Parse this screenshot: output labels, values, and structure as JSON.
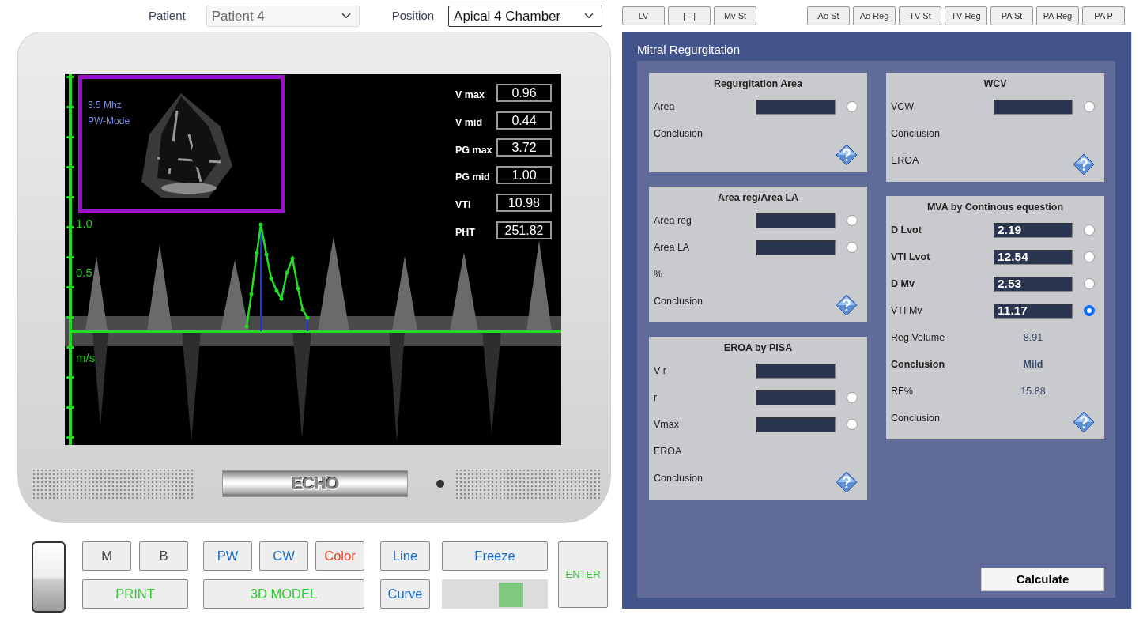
{
  "top_bar": {
    "patient": {
      "label": "Patient",
      "value": "Patient 4",
      "disabled": true
    },
    "position": {
      "label": "Position",
      "value": "Apical 4 Chamber",
      "disabled": false
    }
  },
  "toolbar_groups": [
    [
      "LV",
      "|- -|",
      "Mv St"
    ],
    [
      "Ao St",
      "Ao Reg",
      "TV St",
      "TV Reg",
      "PA St",
      "PA Reg",
      "PA P"
    ]
  ],
  "screen": {
    "mode_lines": [
      "3.5 Mhz",
      "PW-Mode"
    ],
    "axis_labels": [
      "1.0",
      "0.5",
      "m/s"
    ],
    "measurements": [
      {
        "label": "V max",
        "value": "0.96"
      },
      {
        "label": "V mid",
        "value": "0.44"
      },
      {
        "label": "PG max",
        "value": "3.72"
      },
      {
        "label": "PG mid",
        "value": "1.00"
      },
      {
        "label": "VTI",
        "value": "10.98"
      },
      {
        "label": "PHT",
        "value": "251.82"
      }
    ]
  },
  "monitor": {
    "logo": "ECHO"
  },
  "controls": {
    "groups": [
      {
        "buttons": [
          {
            "label": "M",
            "kind": "small",
            "color": "#444444"
          },
          {
            "label": "B",
            "kind": "small",
            "color": "#444444"
          },
          {
            "label": "PRINT",
            "kind": "wide",
            "color": "#2ecc2e"
          }
        ]
      },
      {
        "buttons": [
          {
            "label": "PW",
            "kind": "small",
            "color": "#1a6fd0"
          },
          {
            "label": "CW",
            "kind": "small",
            "color": "#1a6fd0"
          },
          {
            "label": "Color",
            "kind": "small",
            "color": "#f0401c"
          },
          {
            "label": "3D MODEL",
            "kind": "wide",
            "color": "#2ecc2e"
          }
        ]
      },
      {
        "buttons": [
          {
            "label": "Line",
            "kind": "small",
            "color": "#1a6fd0"
          },
          {
            "label": "Curve",
            "kind": "small",
            "color": "#1a6fd0"
          }
        ]
      },
      {
        "buttons": [
          {
            "label": "Freeze",
            "kind": "wide",
            "color": "#1a6fd0"
          }
        ],
        "slider": {
          "level": 0.7
        }
      }
    ],
    "enter": {
      "label": "ENTER",
      "color": "#2ecc2e"
    }
  },
  "panel": {
    "title": "Mitral Regurgitation",
    "columns": [
      [
        {
          "title": "Regurgitation Area",
          "help": true,
          "rows": [
            {
              "kind": "field",
              "label": "Area",
              "bold": false,
              "radio": true,
              "selected": false
            },
            {
              "kind": "text",
              "label": "Conclusion"
            }
          ]
        },
        {
          "title": "Area reg/Area LA",
          "help": true,
          "rows": [
            {
              "kind": "field",
              "label": "Area reg",
              "bold": false,
              "radio": true,
              "selected": false
            },
            {
              "kind": "field",
              "label": "Area LA",
              "bold": false,
              "radio": true,
              "selected": false
            },
            {
              "kind": "text",
              "label": "%"
            },
            {
              "kind": "text",
              "label": "Conclusion"
            }
          ]
        },
        {
          "title": "EROA by PISA",
          "help": true,
          "rows": [
            {
              "kind": "field",
              "label": "V r",
              "bold": false,
              "radio": false
            },
            {
              "kind": "field",
              "label": "r",
              "bold": false,
              "radio": true,
              "selected": false
            },
            {
              "kind": "field",
              "label": "Vmax",
              "bold": false,
              "radio": true,
              "selected": false
            },
            {
              "kind": "text",
              "label": "EROA"
            },
            {
              "kind": "text",
              "label": "Conclusion"
            }
          ]
        }
      ],
      [
        {
          "title": "WCV",
          "help": true,
          "rows": [
            {
              "kind": "field",
              "label": "VCW",
              "bold": false,
              "radio": true,
              "selected": false
            },
            {
              "kind": "text",
              "label": "Conclusion"
            },
            {
              "kind": "text",
              "label": "EROA"
            }
          ]
        },
        {
          "title": "MVA by Continous equestion",
          "help": true,
          "rows": [
            {
              "kind": "field",
              "label": "D Lvot",
              "value": "2.19",
              "bold": true,
              "radio": true,
              "selected": false
            },
            {
              "kind": "field",
              "label": "VTI Lvot",
              "value": "12.54",
              "bold": true,
              "radio": true,
              "selected": false
            },
            {
              "kind": "field",
              "label": "D Mv",
              "value": "2.53",
              "bold": true,
              "radio": true,
              "selected": false
            },
            {
              "kind": "field",
              "label": "VTI Mv",
              "value": "11.17",
              "bold": false,
              "radio": true,
              "selected": true
            },
            {
              "kind": "result",
              "label": "Reg Volume",
              "value": "8.91",
              "bold": false
            },
            {
              "kind": "result",
              "label": "Conclusion",
              "value": "Mild",
              "bold": true
            },
            {
              "kind": "result",
              "label": "RF%",
              "value": "15.88",
              "bold": false
            },
            {
              "kind": "text",
              "label": "Conclusion"
            }
          ]
        }
      ]
    ],
    "calculate": "Calculate"
  }
}
